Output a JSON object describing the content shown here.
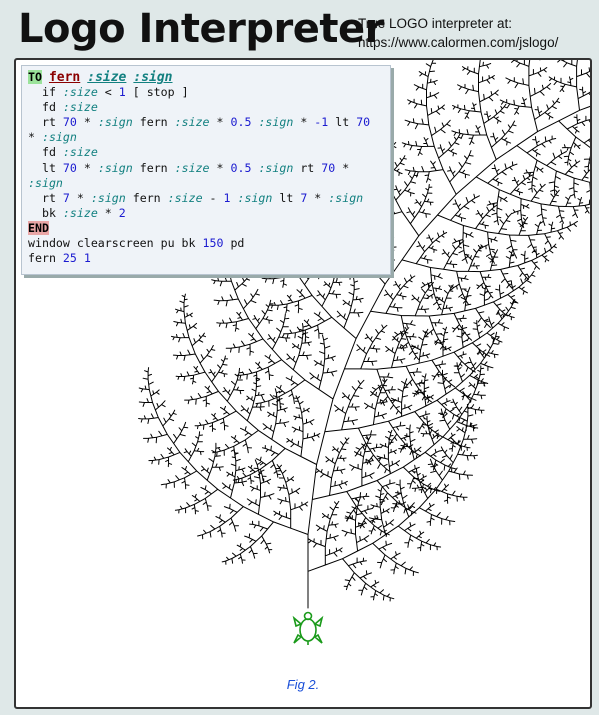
{
  "header": {
    "title": "Logo Interpreter",
    "tagline_line1": "True LOGO interpreter at:",
    "tagline_url": "https://www.calormen.com/jslogo/"
  },
  "editor": {
    "lines": [
      [
        {
          "t": "TO",
          "c": "kw-to"
        },
        {
          "t": " "
        },
        {
          "t": "fern",
          "c": "proc"
        },
        {
          "t": " "
        },
        {
          "t": ":size",
          "c": "param-hdr"
        },
        {
          "t": " "
        },
        {
          "t": ":sign",
          "c": "param-hdr"
        }
      ],
      [
        {
          "t": "  if "
        },
        {
          "t": ":size",
          "c": "param"
        },
        {
          "t": " < "
        },
        {
          "t": "1",
          "c": "num"
        },
        {
          "t": " [ stop ]"
        }
      ],
      [
        {
          "t": "  fd "
        },
        {
          "t": ":size",
          "c": "param"
        }
      ],
      [
        {
          "t": "  rt "
        },
        {
          "t": "70",
          "c": "num"
        },
        {
          "t": " * "
        },
        {
          "t": ":sign",
          "c": "param"
        },
        {
          "t": " fern "
        },
        {
          "t": ":size",
          "c": "param"
        },
        {
          "t": " * "
        },
        {
          "t": "0.5",
          "c": "num"
        },
        {
          "t": " "
        },
        {
          "t": ":sign",
          "c": "param"
        },
        {
          "t": " * "
        },
        {
          "t": "-1",
          "c": "num"
        },
        {
          "t": " lt "
        },
        {
          "t": "70",
          "c": "num"
        },
        {
          "t": "\n"
        },
        {
          "t": "* ",
          "c": "op"
        },
        {
          "t": ":sign",
          "c": "param"
        }
      ],
      [
        {
          "t": "  fd "
        },
        {
          "t": ":size",
          "c": "param"
        }
      ],
      [
        {
          "t": "  lt "
        },
        {
          "t": "70",
          "c": "num"
        },
        {
          "t": " * "
        },
        {
          "t": ":sign",
          "c": "param"
        },
        {
          "t": " fern "
        },
        {
          "t": ":size",
          "c": "param"
        },
        {
          "t": " * "
        },
        {
          "t": "0.5",
          "c": "num"
        },
        {
          "t": " "
        },
        {
          "t": ":sign",
          "c": "param"
        },
        {
          "t": " rt "
        },
        {
          "t": "70",
          "c": "num"
        },
        {
          "t": " * "
        },
        {
          "t": "\n"
        },
        {
          "t": ":sign",
          "c": "param"
        }
      ],
      [
        {
          "t": "  rt "
        },
        {
          "t": "7",
          "c": "num"
        },
        {
          "t": " * "
        },
        {
          "t": ":sign",
          "c": "param"
        },
        {
          "t": " fern "
        },
        {
          "t": ":size",
          "c": "param"
        },
        {
          "t": " - "
        },
        {
          "t": "1",
          "c": "num"
        },
        {
          "t": " "
        },
        {
          "t": ":sign",
          "c": "param"
        },
        {
          "t": " lt "
        },
        {
          "t": "7",
          "c": "num"
        },
        {
          "t": " * "
        },
        {
          "t": ":sign",
          "c": "param"
        }
      ],
      [
        {
          "t": "  bk "
        },
        {
          "t": ":size",
          "c": "param"
        },
        {
          "t": " * "
        },
        {
          "t": "2",
          "c": "num"
        }
      ],
      [
        {
          "t": "END",
          "c": "kw-end"
        }
      ],
      [
        {
          "t": "window clearscreen pu bk "
        },
        {
          "t": "150",
          "c": "num"
        },
        {
          "t": " pd"
        }
      ],
      [
        {
          "t": "fern "
        },
        {
          "t": "25",
          "c": "num"
        },
        {
          "t": " "
        },
        {
          "t": "1",
          "c": "num"
        }
      ]
    ]
  },
  "program": {
    "size": 25,
    "sign": 1,
    "turn_main": 70,
    "turn_curve": 7
  },
  "turtle": {
    "color": "#1a9a1a",
    "icon": "turtle-icon"
  },
  "caption": "Fig 2.",
  "colors": {
    "accent": "#1a4fd8",
    "frame": "#333333",
    "background": "#dfe8e8"
  }
}
